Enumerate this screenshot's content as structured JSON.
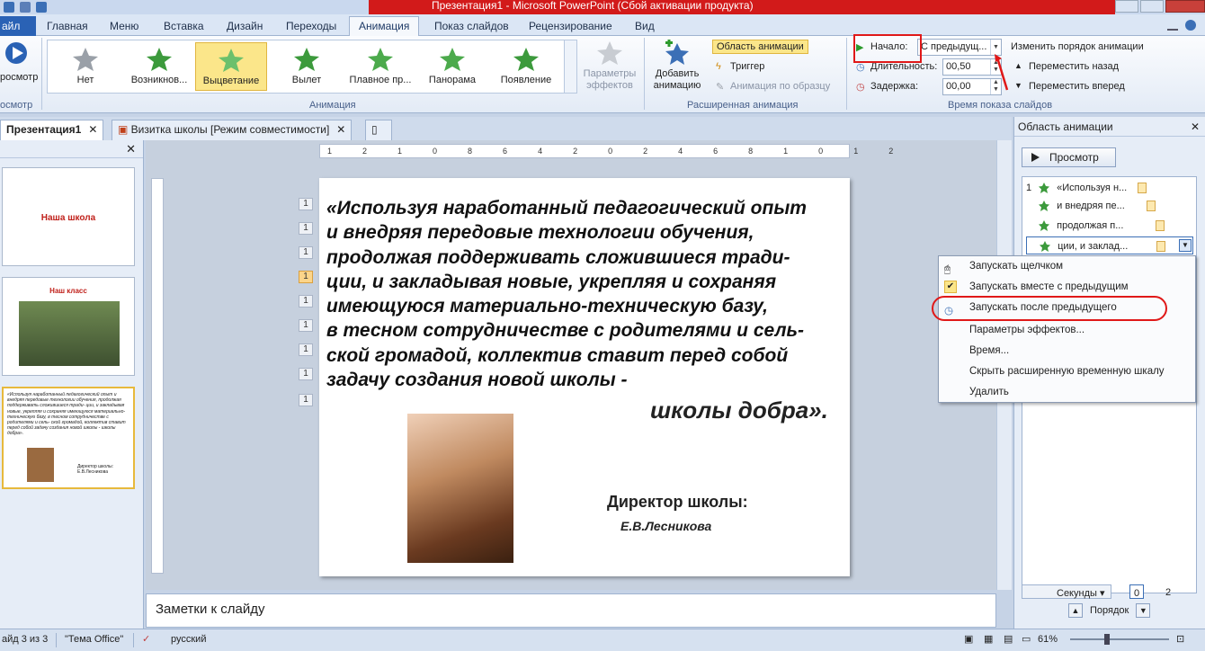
{
  "window": {
    "title": "Презентация1 - Microsoft PowerPoint (Сбой активации продукта)"
  },
  "ribbon_tabs": {
    "file": "айл",
    "tabs": [
      "Главная",
      "Меню",
      "Вставка",
      "Дизайн",
      "Переходы",
      "Анимация",
      "Показ слайдов",
      "Рецензирование",
      "Вид"
    ],
    "active": "Анимация"
  },
  "ribbon": {
    "preview": {
      "label": "росмотр",
      "group": "осмотр"
    },
    "animations": [
      "Нет",
      "Возникнов...",
      "Выцветание",
      "Вылет",
      "Плавное пр...",
      "Панорама",
      "Появление"
    ],
    "selected_animation": "Выцветание",
    "effect_params": "Параметры эффектов",
    "group_animation": "Анимация",
    "add_animation": "Добавить анимацию",
    "animation_pane_btn": "Область анимации",
    "trigger": "Триггер",
    "anim_painter": "Анимация по образцу",
    "group_advanced": "Расширенная анимация",
    "start_label": "Начало:",
    "start_value": "С предыдущ...",
    "duration_label": "Длительность:",
    "duration_value": "00,50",
    "delay_label": "Задержка:",
    "delay_value": "00,00",
    "reorder_title": "Изменить порядок анимации",
    "move_back": "Переместить назад",
    "move_forward": "Переместить вперед",
    "group_timing": "Время показа слайдов"
  },
  "doc_tabs": [
    {
      "label": "Презентация1",
      "close": "✕"
    },
    {
      "label": "Визитка школы [Режим совместимости]",
      "close": "✕"
    }
  ],
  "thumbnails": {
    "slide1_title": "Наша школа",
    "slide2_title": "Наш класс",
    "slide3_text": "«Используя наработанный педагогический опыт и внедряя передовые технологии обучения, продолжая поддерживать сложившиеся тради- ции, и закладывая новые, укрепляя и сохраняя имеющуюся материально-техническую базу, в тесном сотрудничестве с родителями и сель- ской громадой, коллектив ставит перед собой задачу создания новой школы - школы добра».",
    "slide3_sign": "Директор школы: Е.В.Лесникова"
  },
  "slide": {
    "lines": [
      "«Используя наработанный педагогический опыт",
      "и внедряя передовые технологии обучения,",
      "продолжая поддерживать сложившиеся тради-",
      "ции, и закладывая новые, укрепляя и сохраняя",
      "имеющуюся материально-техническую базу,",
      "в тесном сотрудничестве с родителями и сель-",
      "ской громадой, коллектив ставит перед собой",
      "задачу создания новой школы -"
    ],
    "tail": "школы добра».",
    "director": "Директор школы:",
    "name": "Е.В.Лесникова",
    "markers": [
      "1",
      "1",
      "1",
      "1",
      "1",
      "1",
      "1",
      "1",
      "1"
    ]
  },
  "ruler_labels": [
    "12",
    "10",
    "8",
    "6",
    "4",
    "2",
    "0",
    "2",
    "4",
    "6",
    "8",
    "10",
    "12"
  ],
  "notes_placeholder": "Заметки к слайду",
  "animation_pane": {
    "title": "Область анимации",
    "play": "Просмотр",
    "items": [
      {
        "num": "1",
        "label": "«Используя н..."
      },
      {
        "num": "",
        "label": "и внедряя пе..."
      },
      {
        "num": "",
        "label": "продолжая п..."
      },
      {
        "num": "",
        "label": "ции, и заклад..."
      }
    ],
    "seconds": "Секунды",
    "zero": "0",
    "two": "2",
    "order": "Порядок"
  },
  "context_menu": [
    "Запускать щелчком",
    "Запускать вместе с предыдущим",
    "Запускать после предыдущего",
    "Параметры эффектов...",
    "Время...",
    "Скрыть расширенную временную шкалу",
    "Удалить"
  ],
  "status": {
    "slide": "айд 3 из 3",
    "theme": "\"Тема Office\"",
    "lang": "русский",
    "zoom": "61%"
  },
  "colors": {
    "accent": "#2a62b5",
    "highlight": "#fbe68a",
    "annotation_red": "#e01818",
    "slide_title_red": "#c0201a"
  }
}
